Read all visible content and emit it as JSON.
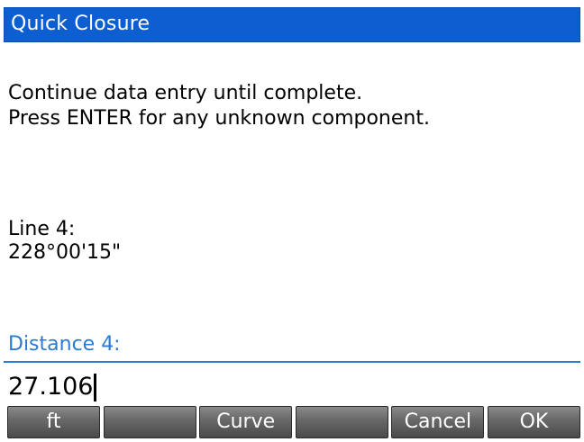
{
  "window": {
    "title": "Quick Closure"
  },
  "instructions": {
    "line1": "Continue data entry until complete.",
    "line2": "Press ENTER for any unknown component."
  },
  "previous": {
    "label": "Line 4:",
    "value": "228°00'15\""
  },
  "field": {
    "label": "Distance 4:",
    "value": "27.106"
  },
  "softkeys": [
    {
      "label": "ft"
    },
    {
      "label": ""
    },
    {
      "label": "Curve"
    },
    {
      "label": ""
    },
    {
      "label": "Cancel"
    },
    {
      "label": "OK"
    }
  ],
  "colors": {
    "titlebar": "#0c5ed1",
    "field_label": "#2a7bd1",
    "softkey": "#6a6a6a"
  }
}
